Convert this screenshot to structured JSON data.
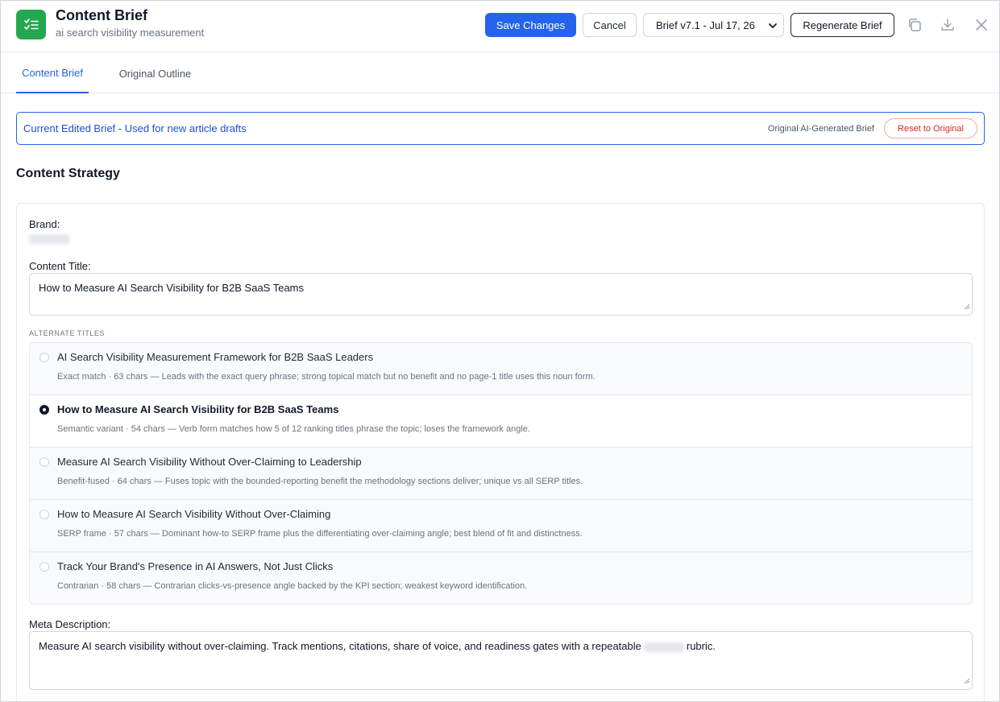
{
  "header": {
    "title": "Content Brief",
    "subtitle": "ai search visibility measurement",
    "save_label": "Save Changes",
    "cancel_label": "Cancel",
    "version_selected": "Brief v7.1 - Jul 17, 26",
    "regenerate_label": "Regenerate Brief",
    "icons": [
      "copy-icon",
      "download-icon",
      "close-icon"
    ],
    "app_icon": "checklist-icon",
    "accent_color": "#2563eb",
    "app_icon_color": "#22a94f"
  },
  "tabs": [
    {
      "label": "Content Brief",
      "active": true
    },
    {
      "label": "Original Outline",
      "active": false
    }
  ],
  "banner": {
    "current_label": "Current Edited Brief - Used for new article drafts",
    "original_label": "Original AI-Generated Brief",
    "reset_label": "Reset to Original"
  },
  "section": {
    "title": "Content Strategy"
  },
  "form": {
    "brand_label": "Brand:",
    "content_title_label": "Content Title:",
    "content_title_value": "How to Measure AI Search Visibility for B2B SaaS Teams",
    "alternate_titles_label": "ALTERNATE TITLES",
    "alternate_titles": [
      {
        "title": "AI Search Visibility Measurement Framework for B2B SaaS Leaders",
        "desc": "Exact match · 63 chars — Leads with the exact query phrase; strong topical match but no benefit and no page-1 title uses this noun form.",
        "selected": false
      },
      {
        "title": "How to Measure AI Search Visibility for B2B SaaS Teams",
        "desc": "Semantic variant · 54 chars — Verb form matches how 5 of 12 ranking titles phrase the topic; loses the framework angle.",
        "selected": true
      },
      {
        "title": "Measure AI Search Visibility Without Over-Claiming to Leadership",
        "desc": "Benefit-fused · 64 chars — Fuses topic with the bounded-reporting benefit the methodology sections deliver; unique vs all SERP titles.",
        "selected": false
      },
      {
        "title": "How to Measure AI Search Visibility Without Over-Claiming",
        "desc": "SERP frame · 57 chars — Dominant how-to SERP frame plus the differentiating over-claiming angle; best blend of fit and distinctness.",
        "selected": false
      },
      {
        "title": "Track Your Brand's Presence in AI Answers, Not Just Clicks",
        "desc": "Contrarian · 58 chars — Contrarian clicks-vs-presence angle backed by the KPI section; weakest keyword identification.",
        "selected": false
      }
    ],
    "meta_label": "Meta Description:",
    "meta_before": "Measure AI search visibility without over-claiming. Track mentions, citations, share of voice, and readiness gates with a repeatable",
    "meta_after": "rubric."
  }
}
